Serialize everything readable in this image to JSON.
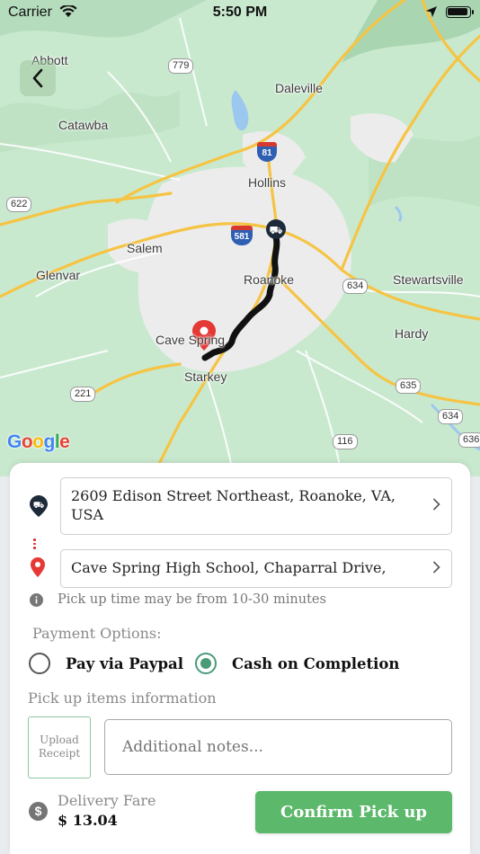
{
  "status_bar": {
    "carrier": "Carrier",
    "time": "5:50 PM"
  },
  "map": {
    "place_labels": [
      "Abbott",
      "Catawba",
      "Daleville",
      "Hollins",
      "Salem",
      "Glenvar",
      "Roanoke",
      "Stewartsville",
      "Cave Spring",
      "Hardy",
      "Starkey"
    ],
    "route_shields": [
      "779",
      "81",
      "622",
      "581",
      "634",
      "635",
      "221",
      "634",
      "116",
      "636"
    ],
    "attribution": "Google",
    "colors": {
      "land": "#c9e9cf",
      "urban": "#ececec",
      "road_major": "#f6c444",
      "water": "#9cc7ef",
      "route": "#111111",
      "destination_pin": "#e53935"
    }
  },
  "pickup": {
    "address": "2609 Edison Street Northeast, Roanoke, VA, USA"
  },
  "dropoff": {
    "address": "Cave Spring High School, Chaparral Drive,"
  },
  "info": {
    "pickup_time_note": "Pick up time may be from 10-30 minutes"
  },
  "payment": {
    "label": "Payment Options:",
    "options": [
      {
        "label": "Pay via Paypal",
        "selected": false
      },
      {
        "label": "Cash on Completion",
        "selected": true
      }
    ],
    "accent_color": "#4a9a78"
  },
  "items": {
    "label": "Pick up items information",
    "upload_label": "Upload Receipt",
    "notes_placeholder": "Additional notes..."
  },
  "fare": {
    "label": "Delivery Fare",
    "value": "$ 13.04"
  },
  "actions": {
    "confirm_label": "Confirm Pick up",
    "confirm_color": "#5cb86a"
  }
}
